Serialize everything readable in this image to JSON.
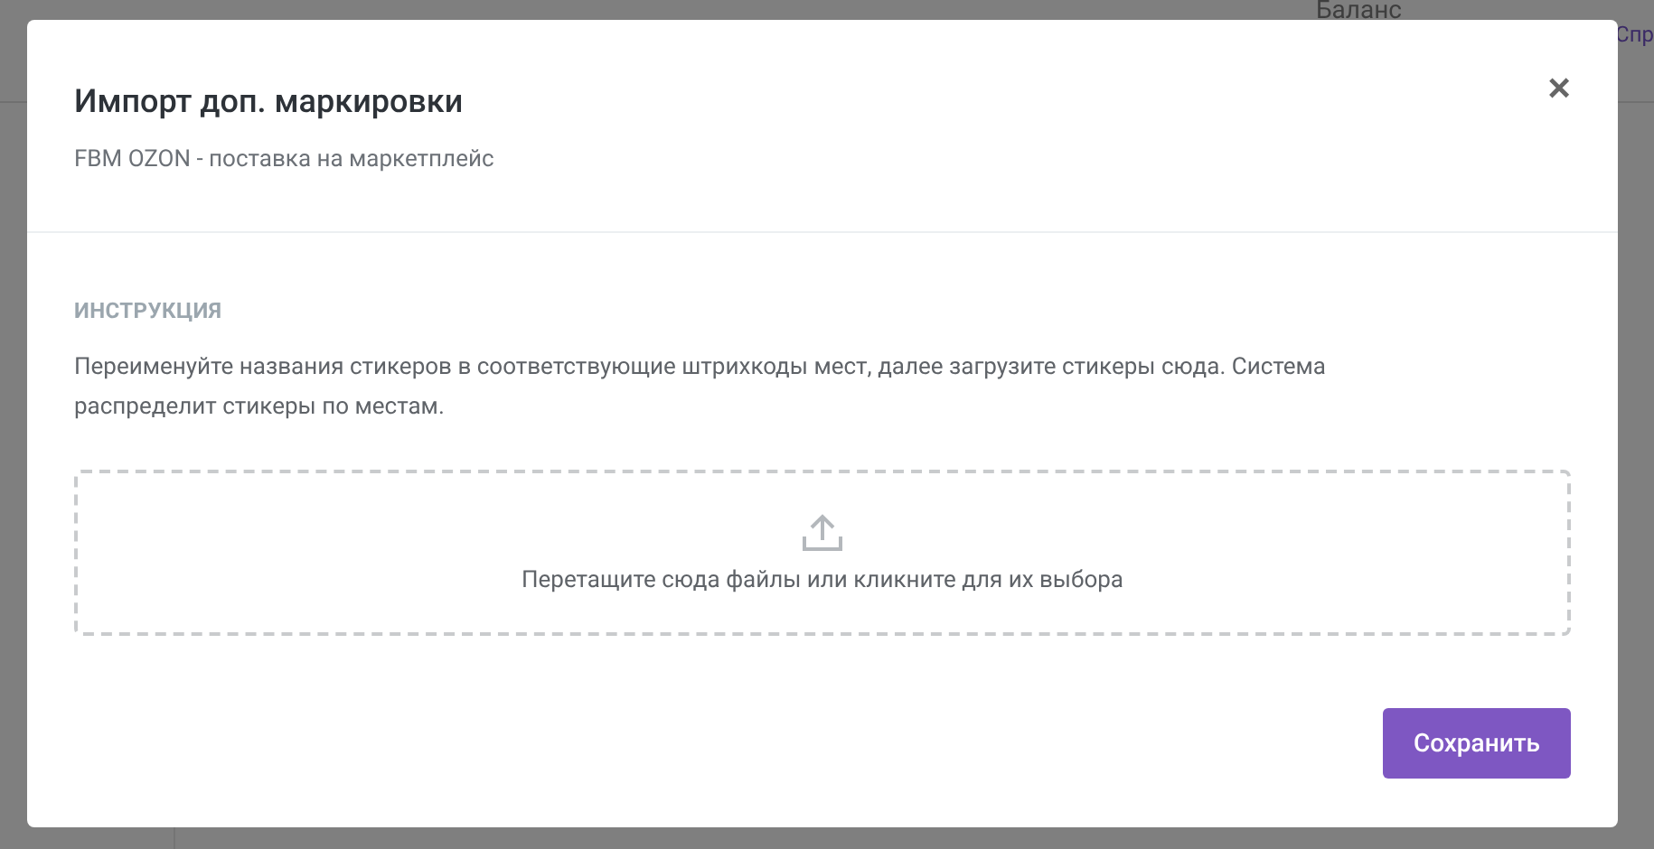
{
  "background": {
    "balance_label": "Баланс",
    "help_link": "Спр"
  },
  "dialog": {
    "title": "Импорт доп. маркировки",
    "subtitle": "FBM OZON - поставка на маркетплейс",
    "close": "×",
    "section_title": "ИНСТРУКЦИЯ",
    "instruction": "Переименуйте названия стикеров в соответствующие штрихкоды мест, далее загрузите стикеры сюда. Система распределит стикеры по местам.",
    "dropzone": {
      "text": "Перетащите сюда файлы или кликните для их выбора"
    },
    "buttons": [
      {
        "label": "Сохранить",
        "kind": "primary"
      }
    ]
  }
}
